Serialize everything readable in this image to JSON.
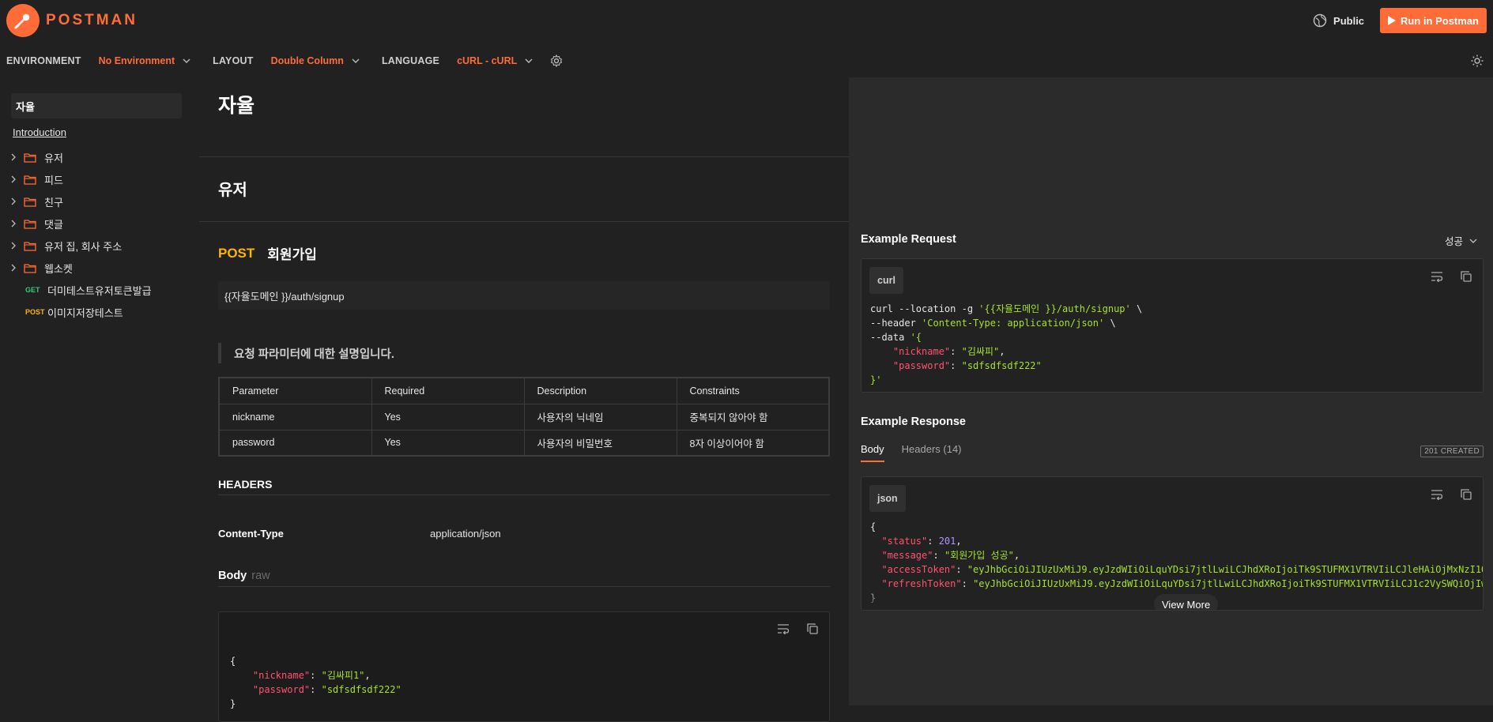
{
  "header": {
    "brand": "POSTMAN",
    "public_label": "Public",
    "run_label": "Run in Postman"
  },
  "settings": {
    "environment_label": "ENVIRONMENT",
    "environment_value": "No Environment",
    "layout_label": "LAYOUT",
    "layout_value": "Double Column",
    "language_label": "LANGUAGE",
    "language_value": "cURL - cURL"
  },
  "sidebar": {
    "title": "자율",
    "intro": "Introduction",
    "folders": [
      "유저",
      "피드",
      "친구",
      "댓글",
      "유저 집, 회사 주소",
      "웹소켓"
    ],
    "requests": [
      {
        "method": "GET",
        "name": "더미테스트유저토큰발급"
      },
      {
        "method": "POST",
        "name": "이미지저장테스트"
      }
    ]
  },
  "main": {
    "collection_title": "자율",
    "folder_title": "유저",
    "request": {
      "method": "POST",
      "name": "회원가입",
      "url": "{{자율도메인 }}/auth/signup",
      "description": "요청 파라미터에 대한 설명입니다."
    },
    "params_table": {
      "headers": [
        "Parameter",
        "Required",
        "Description",
        "Constraints"
      ],
      "rows": [
        [
          "nickname",
          "Yes",
          "사용자의 닉네임",
          "중복되지 않아야 함"
        ],
        [
          "password",
          "Yes",
          "사용자의 비밀번호",
          "8자 이상이어야 함"
        ]
      ]
    },
    "headers_section": "HEADERS",
    "header_key": "Content-Type",
    "header_value": "application/json",
    "body_label": "Body",
    "body_mode": "raw",
    "body_code": {
      "open": "{",
      "k1": "\"nickname\"",
      "v1": "\"김싸피1\"",
      "k2": "\"password\"",
      "v2": "\"sdfsdfsdf222\"",
      "close": "}"
    }
  },
  "right": {
    "example_request_title": "Example Request",
    "example_select": "성공",
    "request_lang": "curl",
    "curl": {
      "l1_a": "curl --location -g ",
      "l1_b": "'{{자율도메인 }}/auth/signup'",
      "l1_c": " \\",
      "l2_a": "--header ",
      "l2_b": "'Content-Type: application/json'",
      "l2_c": " \\",
      "l3_a": "--data ",
      "l3_b": "'{",
      "k1": "\"nickname\"",
      "v1": "\"김싸피\"",
      "k2": "\"password\"",
      "v2": "\"sdfsdfsdf222\"",
      "l6": "}'"
    },
    "example_response_title": "Example Response",
    "tab_body": "Body",
    "tab_headers": "Headers (14)",
    "status_badge": "201 CREATED",
    "response_lang": "json",
    "response": {
      "open": "{",
      "k_status": "\"status\"",
      "v_status": "201",
      "k_message": "\"message\"",
      "v_message": "\"회원가입 성공\"",
      "k_access": "\"accessToken\"",
      "v_access": "\"eyJhbGciOiJIUzUxMiJ9.eyJzdWIiOiLquYDsi7jtlLwiLCJhdXRoIjoiTk9STUFMX1VTRVIiLCJleHAiOjMxNzI1O",
      "k_refresh": "\"refreshToken\"",
      "v_refresh": "\"eyJhbGciOiJIUzUxMiJ9.eyJzdWIiOiLquYDsi7jtlLwiLCJhdXRoIjoiTk9STUFMX1VTRVIiLCJ1c2VySWQiOjIw",
      "close": "}"
    },
    "view_more": "View More"
  },
  "colors": {
    "accent": "#ff6c37",
    "post": "#ffb400",
    "get": "#2ecc71",
    "json_key": "#ff5370",
    "json_string": "#a6e22e",
    "json_number": "#b294ff"
  }
}
